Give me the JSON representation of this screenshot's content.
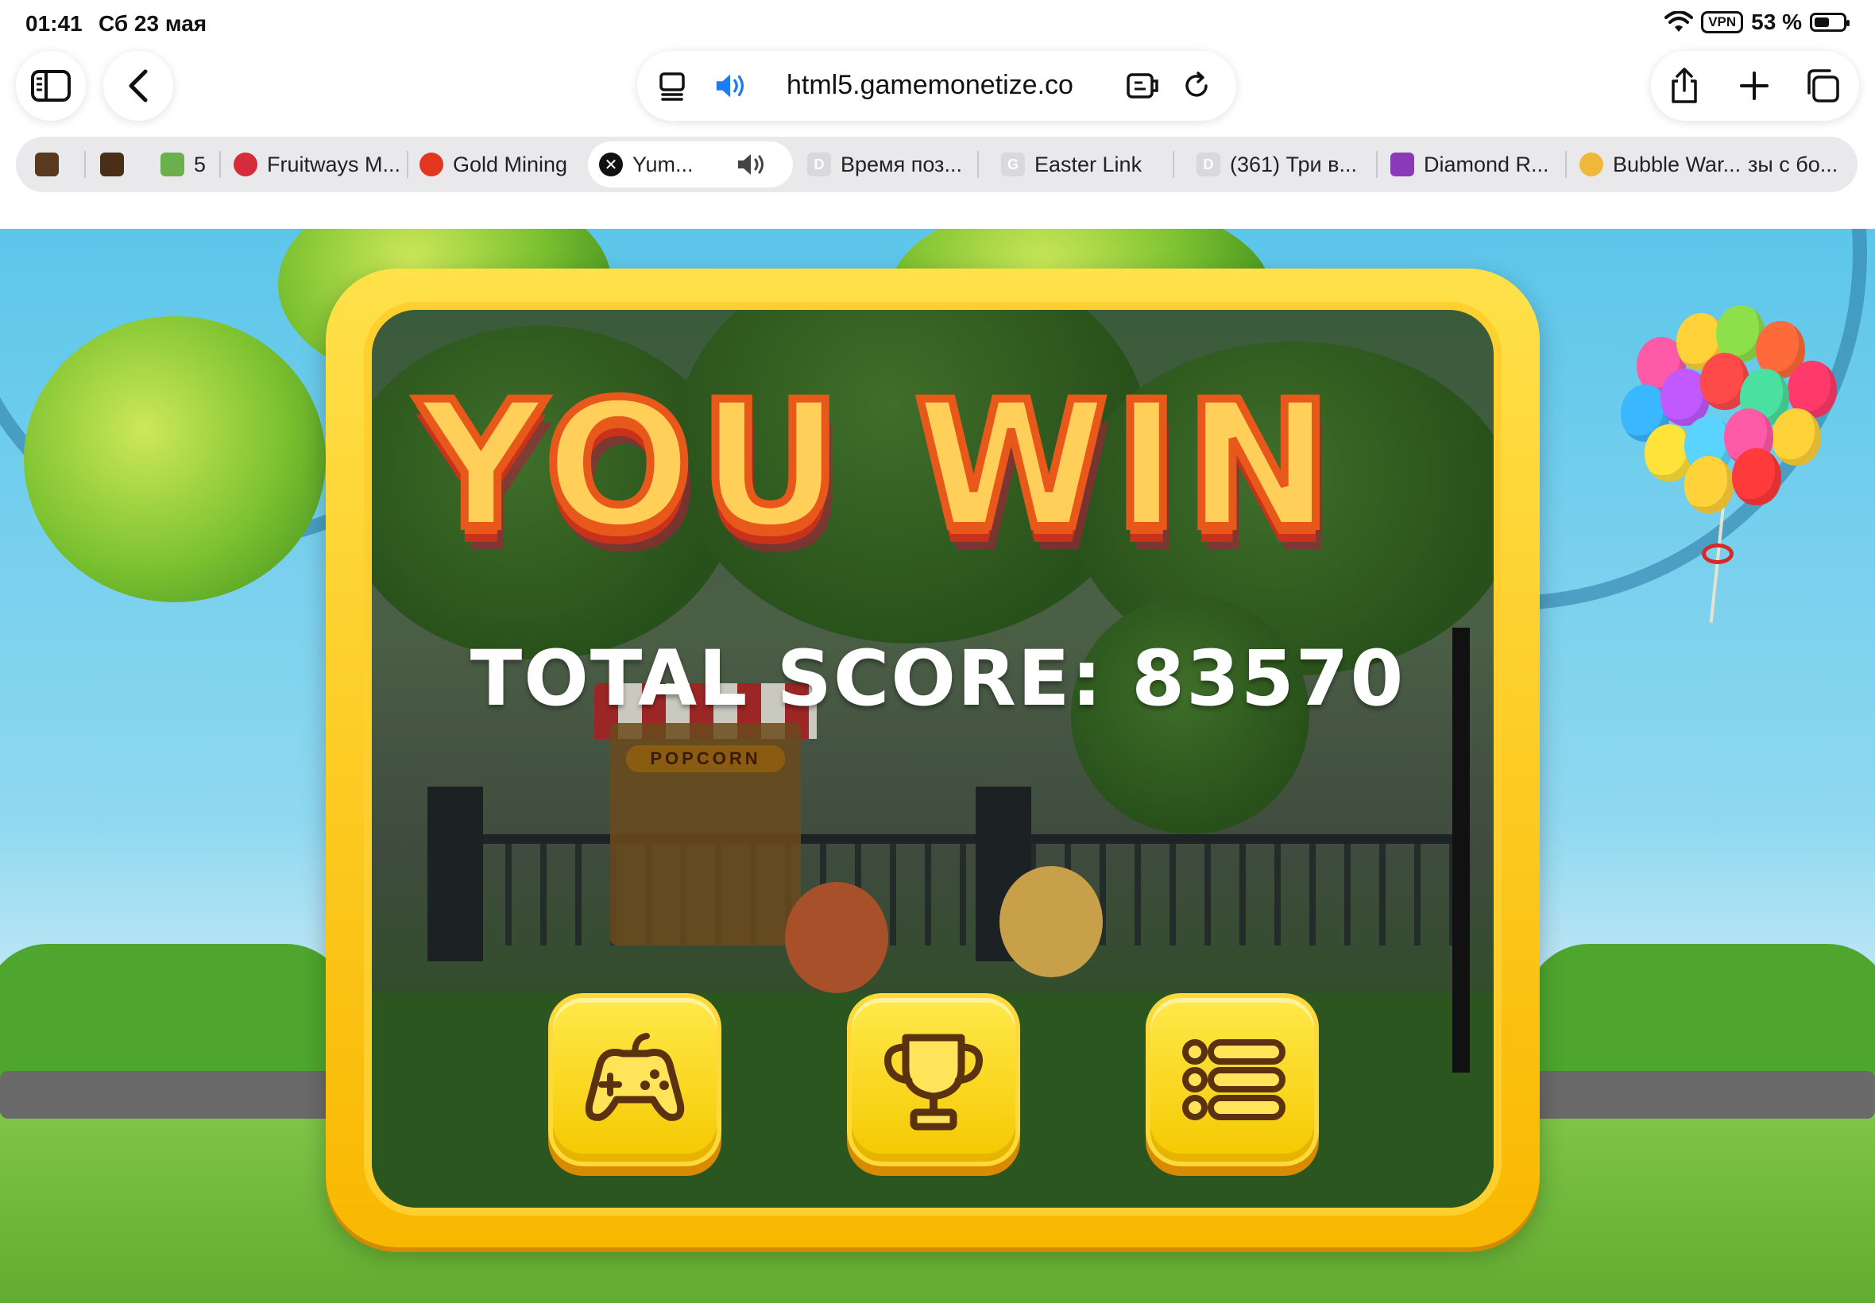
{
  "status": {
    "time": "01:41",
    "date": "Сб 23 мая",
    "vpn": "VPN",
    "battery": "53 %",
    "battery_level": 0.53
  },
  "toolbar": {
    "url": "html5.gamemonetize.co"
  },
  "tabs": [
    {
      "label": "",
      "favicon": "game-thumb"
    },
    {
      "label": "",
      "favicon": "game-thumb"
    },
    {
      "label": "5",
      "favicon": "tab-group-icon"
    },
    {
      "label": "Fruitways M...",
      "favicon": "strawberry-icon"
    },
    {
      "label": "Gold Mining",
      "favicon": "gold-mining-icon"
    },
    {
      "label": "Yum...",
      "favicon": "close-icon",
      "active": true
    },
    {
      "label": "Время поз...",
      "favicon": "D"
    },
    {
      "label": "Easter Link",
      "favicon": "G"
    },
    {
      "label": "(361) Три в...",
      "favicon": "D"
    },
    {
      "label": "Diamond R...",
      "favicon": "diamond-icon"
    },
    {
      "label": "Bubble War...",
      "favicon": "bubble-icon"
    },
    {
      "label": "зы с бо...",
      "favicon": ""
    }
  ],
  "game": {
    "title": "YOU WIN",
    "score_text": "TOTAL SCORE: 83570",
    "popcorn_sign": "POPCORN",
    "buttons": [
      {
        "name": "play-again-button",
        "icon": "gamepad-icon"
      },
      {
        "name": "leaderboard-button",
        "icon": "trophy-icon"
      },
      {
        "name": "levels-menu-button",
        "icon": "list-icon"
      }
    ]
  },
  "colors": {
    "frame": "#f9b700",
    "title_fill": "#ffcf5a",
    "title_stroke": "#e8581a",
    "button": "#f5c800"
  }
}
